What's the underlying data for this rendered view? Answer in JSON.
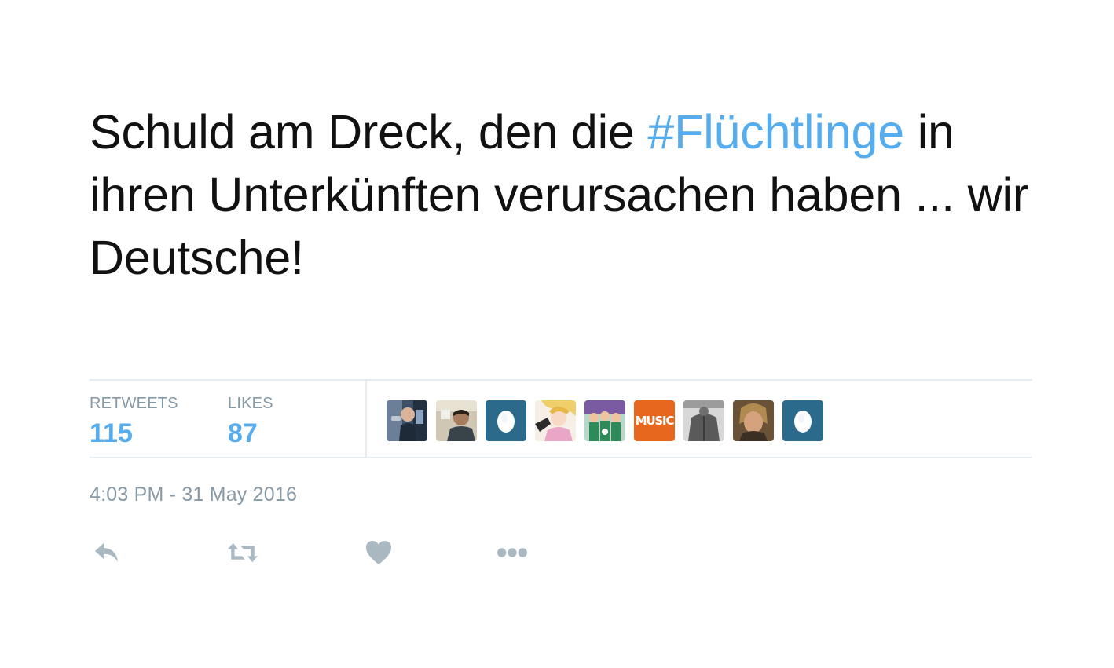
{
  "tweet": {
    "text_before": "Schuld am Dreck, den die ",
    "hashtag": "#Flüchtlinge",
    "text_after": " in ihren Unterkünften verursachen haben ... wir Deutsche!"
  },
  "stats": {
    "retweets_label": "RETWEETS",
    "retweets_count": "115",
    "likes_label": "LIKES",
    "likes_count": "87"
  },
  "avatars": {
    "music_badge_text": "MUSIC"
  },
  "timestamp": "4:03 PM - 31 May 2016",
  "actions": [
    "reply-icon",
    "retweet-icon",
    "heart-icon",
    "more-icon"
  ],
  "colors": {
    "link": "#55acee",
    "muted": "#8899a6",
    "divider": "#e6ecf0",
    "text": "#111111",
    "egg_background": "#2b6a8a",
    "music_background": "#e8671f"
  }
}
